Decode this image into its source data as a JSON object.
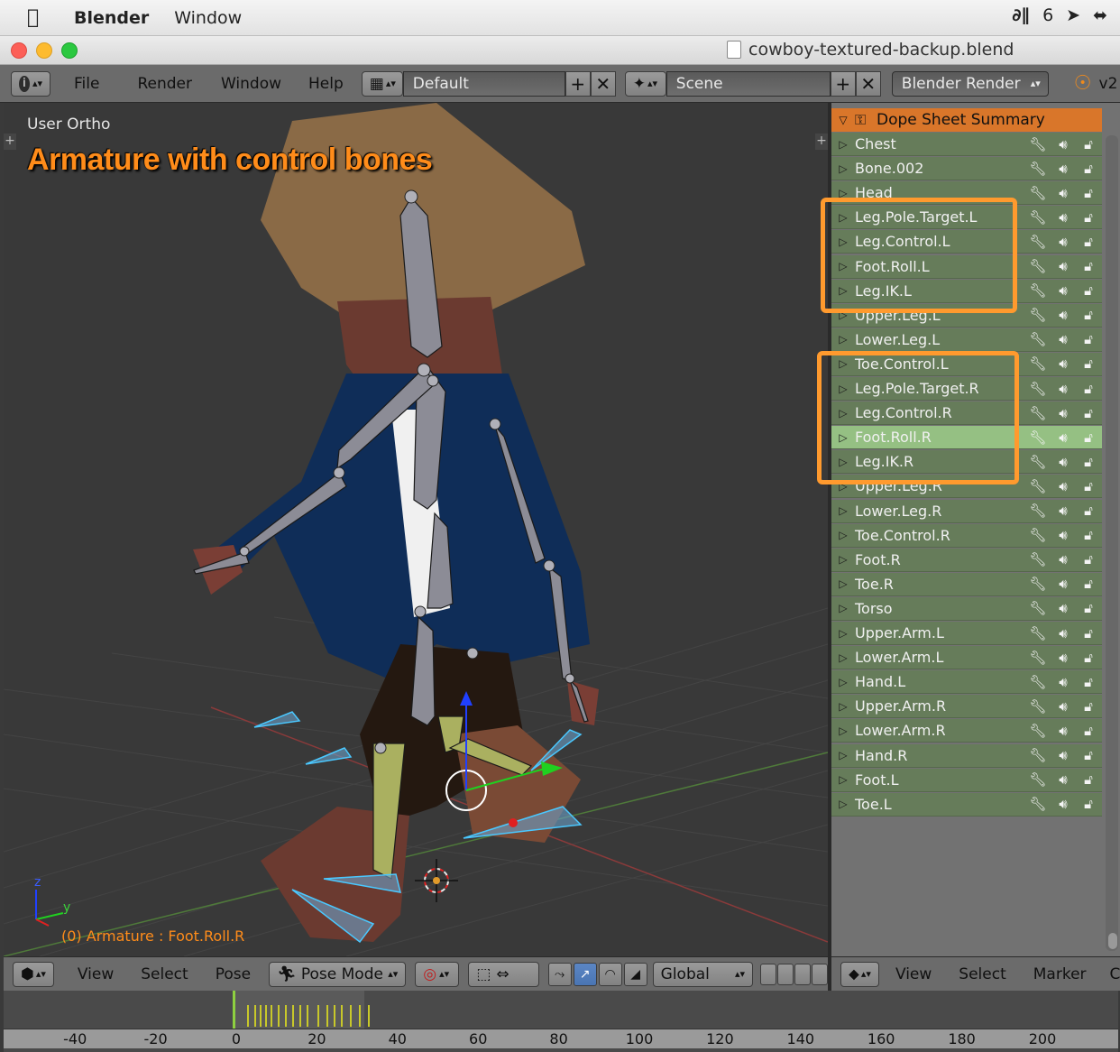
{
  "menubar": {
    "app": "Blender",
    "items": [
      "Window"
    ],
    "right_status": "6"
  },
  "window": {
    "title": "cowboy-textured-backup.blend"
  },
  "header": {
    "menus": [
      "File",
      "Render",
      "Window",
      "Help"
    ],
    "layout": "Default",
    "scene": "Scene",
    "engine": "Blender Render",
    "version_stub": "v2"
  },
  "viewport": {
    "view_label": "User Ortho",
    "annotation": "Armature with control bones",
    "status": "(0) Armature : Foot.Roll.R",
    "axis_z": "z",
    "axis_y": "y"
  },
  "dopesheet": {
    "summary": "Dope Sheet Summary",
    "channels": [
      "Chest",
      "Bone.002",
      "Head",
      "Leg.Pole.Target.L",
      "Leg.Control.L",
      "Foot.Roll.L",
      "Leg.IK.L",
      "Upper.Leg.L",
      "Lower.Leg.L",
      "Toe.Control.L",
      "Leg.Pole.Target.R",
      "Leg.Control.R",
      "Foot.Roll.R",
      "Leg.IK.R",
      "Upper.Leg.R",
      "Lower.Leg.R",
      "Toe.Control.R",
      "Foot.R",
      "Toe.R",
      "Torso",
      "Upper.Arm.L",
      "Lower.Arm.L",
      "Hand.L",
      "Upper.Arm.R",
      "Lower.Arm.R",
      "Hand.R",
      "Foot.L",
      "Toe.L"
    ],
    "selected": "Foot.Roll.R"
  },
  "viewport_footer": {
    "view": "View",
    "select": "Select",
    "pose": "Pose",
    "mode": "Pose Mode",
    "orientation": "Global"
  },
  "dope_footer": {
    "view": "View",
    "select": "Select",
    "marker": "Marker",
    "c": "C"
  },
  "timeline": {
    "ticks": [
      "-40",
      "-20",
      "0",
      "20",
      "40",
      "60",
      "80",
      "100",
      "120",
      "140",
      "160",
      "180",
      "200"
    ],
    "current_frame": 0
  }
}
